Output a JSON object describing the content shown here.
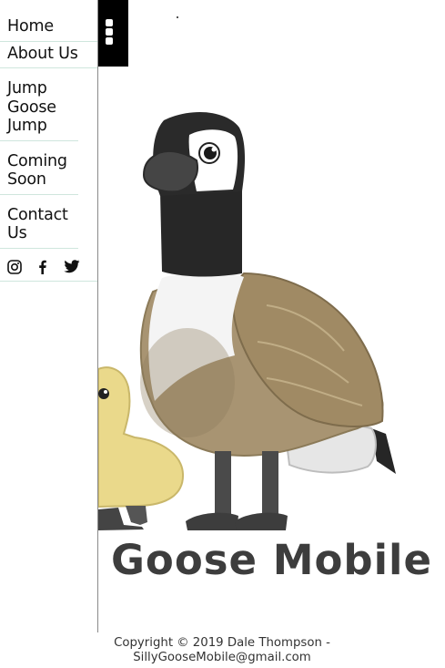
{
  "nav": {
    "items": [
      {
        "label": "Home"
      },
      {
        "label": "About Us"
      },
      {
        "label": "Jump Goose Jump"
      },
      {
        "label": "Coming Soon"
      },
      {
        "label": "Contact Us"
      }
    ],
    "social_icons": [
      "instagram-icon",
      "facebook-icon",
      "twitter-icon"
    ]
  },
  "menu_toggle": {
    "icon": "kebab-menu-icon"
  },
  "hero": {
    "brand_text": "y Goose Mobile",
    "image_subjects": [
      "canada-goose",
      "yellow-gosling"
    ]
  },
  "footer": {
    "line1": "Copyright © 2019 Dale Thompson -",
    "line2": "SillyGooseMobile@gmail.com"
  },
  "colors": {
    "sidebar_bg": "#ffffff",
    "menu_toggle_bg": "#000000",
    "divider": "#cfe6dd",
    "brand_text": "#3d3d3d",
    "goose_body": "#a8956f",
    "gosling": "#f0e68c"
  }
}
